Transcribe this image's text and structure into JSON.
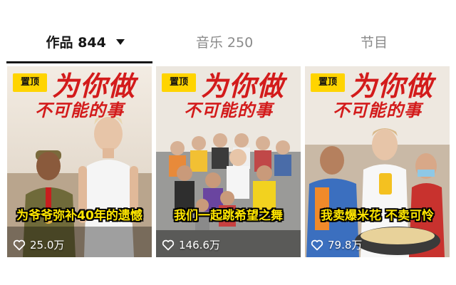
{
  "tabs": {
    "works": {
      "label": "作品",
      "count": "844"
    },
    "music": {
      "label": "音乐",
      "count": "250"
    },
    "programs": {
      "label": "节目"
    }
  },
  "cards": [
    {
      "pin": "置顶",
      "headline_line1": "为你做",
      "headline_line2": "不可能的事",
      "caption": "为爷爷弥补40年的遗憾",
      "likes": "25.0万"
    },
    {
      "pin": "置顶",
      "headline_line1": "为你做",
      "headline_line2": "不可能的事",
      "caption": "我们一起跳希望之舞",
      "likes": "146.6万"
    },
    {
      "pin": "置顶",
      "headline_line1": "为你做",
      "headline_line2": "不可能的事",
      "caption": "我卖爆米花 不卖可怜",
      "likes": "79.8万"
    }
  ],
  "icons": {
    "likes": "heart-outline-icon",
    "works_dropdown": "caret-down-icon"
  },
  "colors": {
    "pin_bg": "#ffd400",
    "headline": "#d31b1b",
    "caption": "#ffe600",
    "active_tab": "#161616",
    "inactive_tab": "#8a8a8a"
  }
}
